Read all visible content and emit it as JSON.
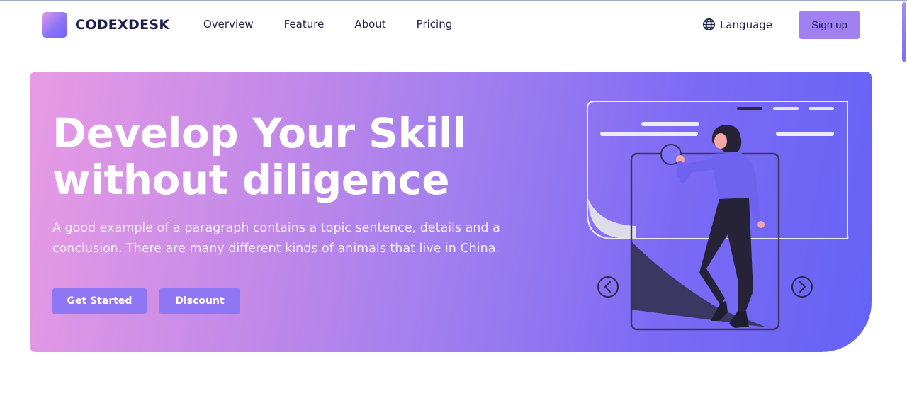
{
  "brand": {
    "name": "CODEXDESK",
    "logo_icon": "gradient-square-logo"
  },
  "nav": [
    {
      "label": "Overview"
    },
    {
      "label": "Feature"
    },
    {
      "label": "About"
    },
    {
      "label": "Pricing"
    }
  ],
  "header": {
    "language_label": "Language",
    "language_icon": "globe-icon",
    "signup_label": "Sign up"
  },
  "hero": {
    "title_line1": "Develop Your Skill",
    "title_line2": "without diligence",
    "description": "A good example of a paragraph contains a topic sentence, details and a conclusion. There are many different kinds of animals that live in China.",
    "primary_button": "Get Started",
    "secondary_button": "Discount",
    "illustration": {
      "prev_icon": "chevron-left-icon",
      "next_icon": "chevron-right-icon"
    }
  },
  "colors": {
    "brand_dark": "#1c1f4d",
    "accent": "#a180f2",
    "gradient_start": "#e89be4",
    "gradient_end": "#6463f6"
  }
}
